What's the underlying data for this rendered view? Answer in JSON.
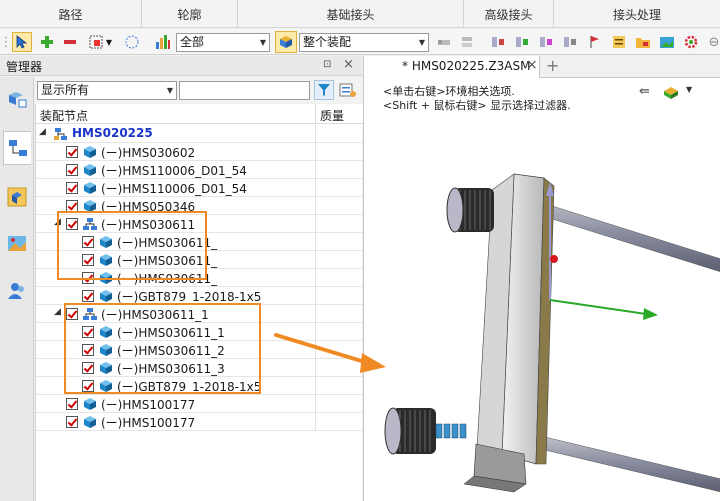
{
  "ribbon": {
    "tabs": [
      "路径",
      "轮廓",
      "基础接头",
      "高级接头",
      "接头处理"
    ]
  },
  "toolbar": {
    "filter_select": "全部",
    "scope_select": "整个装配"
  },
  "manager": {
    "title": "管理器",
    "pin_icon": "pin-icon",
    "close_icon": "close-icon"
  },
  "filter": {
    "display_select": "显示所有",
    "search_placeholder": ""
  },
  "tree": {
    "col_node": "装配节点",
    "col_mass": "质量",
    "root": "HMS020225",
    "rows": [
      {
        "label": "(ー)HMS030602",
        "level": 1,
        "type": "part"
      },
      {
        "label": "(ー)HMS110006_D01_54",
        "level": 1,
        "type": "part"
      },
      {
        "label": "(ー)HMS110006_D01_54",
        "level": 1,
        "type": "part"
      },
      {
        "label": "(ー)HMS050346",
        "level": 1,
        "type": "part"
      },
      {
        "label": "(ー)HMS030611",
        "level": 1,
        "type": "asm",
        "expanded": true
      },
      {
        "label": "(ー)HMS030611_",
        "level": 2,
        "type": "part"
      },
      {
        "label": "(ー)HMS030611_",
        "level": 2,
        "type": "part"
      },
      {
        "label": "(ー)HMS030611_",
        "level": 2,
        "type": "part"
      },
      {
        "label": "(ー)GBT879_1-2018-1x5",
        "level": 2,
        "type": "part"
      },
      {
        "label": "(ー)HMS030611_1",
        "level": 1,
        "type": "asm",
        "expanded": true
      },
      {
        "label": "(ー)HMS030611_1",
        "level": 2,
        "type": "part"
      },
      {
        "label": "(ー)HMS030611_2",
        "level": 2,
        "type": "part"
      },
      {
        "label": "(ー)HMS030611_3",
        "level": 2,
        "type": "part"
      },
      {
        "label": "(ー)GBT879_1-2018-1x5",
        "level": 2,
        "type": "part"
      },
      {
        "label": "(ー)HMS100177",
        "level": 1,
        "type": "part"
      },
      {
        "label": "(ー)HMS100177",
        "level": 1,
        "type": "part"
      }
    ]
  },
  "doc": {
    "tab_title": "* HMS020225.Z3ASM",
    "close": "×",
    "add": "+",
    "hint1": "<单击右键>环境相关选项.",
    "hint2": "<Shift + 鼠标右键> 显示选择过滤器."
  },
  "colors": {
    "highlight": "#f08a24",
    "check": "#d00000",
    "cube": "#1f86c8",
    "root_text": "#1a35c8"
  }
}
